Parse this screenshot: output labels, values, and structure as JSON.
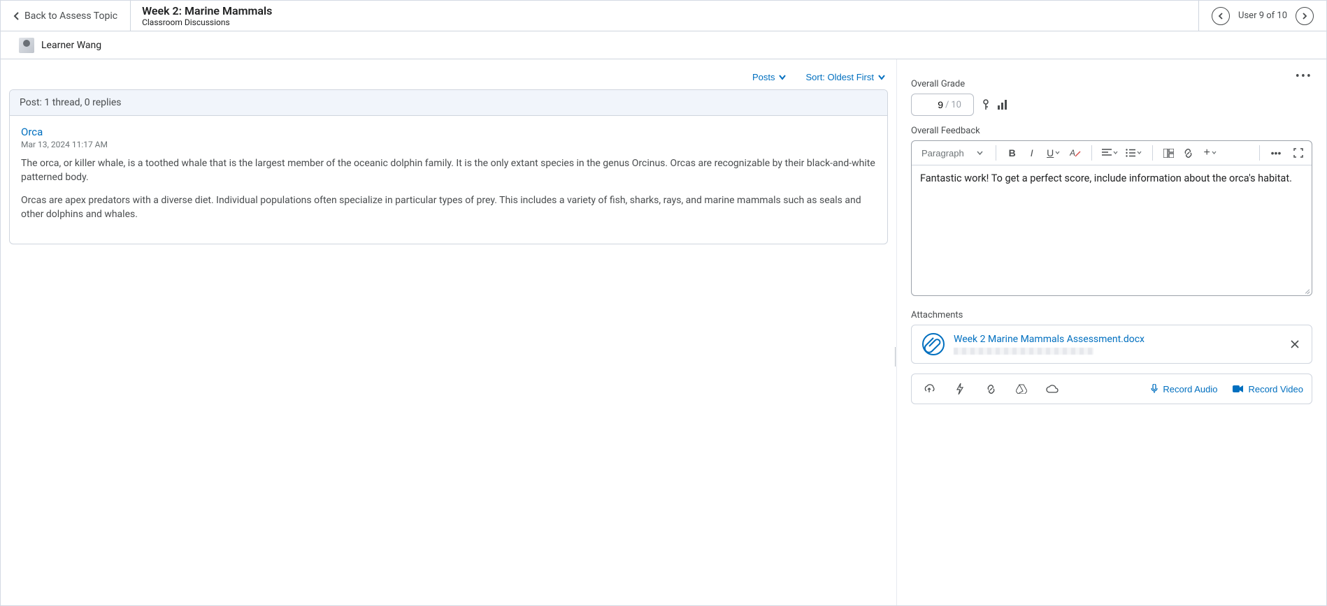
{
  "header": {
    "back_label": "Back to Assess Topic",
    "topic_title": "Week 2: Marine Mammals",
    "topic_subtitle": "Classroom Discussions",
    "user_nav_label": "User 9 of 10"
  },
  "learner": {
    "name": "Learner Wang"
  },
  "filters": {
    "posts_label": "Posts",
    "sort_label": "Sort: Oldest First"
  },
  "post": {
    "header_label": "Post: 1 thread, 0 replies",
    "title": "Orca",
    "date": "Mar 13, 2024 11:17 AM",
    "para1": "The orca, or killer whale, is a toothed whale that is the largest member of the oceanic dolphin family. It is the only extant species in the genus Orcinus. Orcas are recognizable by their black-and-white patterned body.",
    "para2": "Orcas are apex predators with a diverse diet. Individual populations often specialize in particular types of prey. This includes a variety of fish, sharks, rays, and marine mammals such as seals and other dolphins and whales."
  },
  "grading": {
    "overall_grade_label": "Overall Grade",
    "grade_value": "9",
    "grade_max": "10",
    "overall_feedback_label": "Overall Feedback",
    "paragraph_btn": "Paragraph",
    "feedback_text": "Fantastic work! To get a perfect score, include information about the orca's habitat.",
    "attachments_label": "Attachments",
    "attachment_name": "Week 2 Marine Mammals Assessment.docx",
    "record_audio_label": "Record Audio",
    "record_video_label": "Record Video"
  }
}
